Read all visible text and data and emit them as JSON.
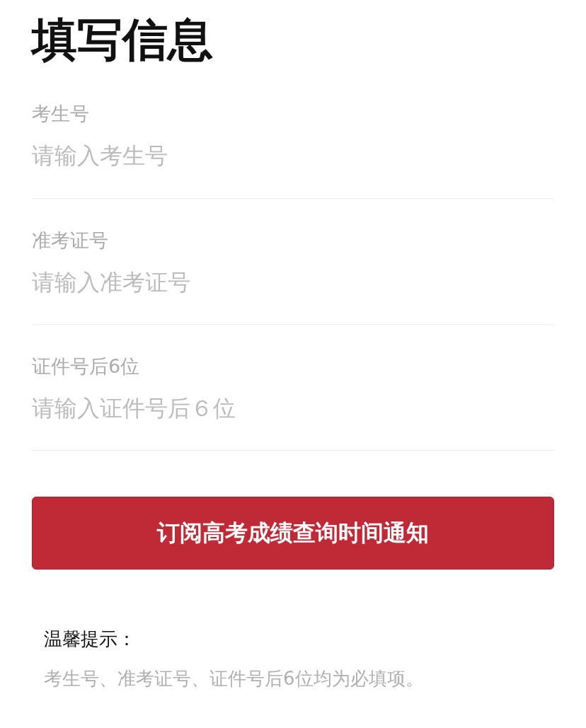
{
  "title": "填写信息",
  "fields": [
    {
      "label": "考生号",
      "placeholder": "请输入考生号"
    },
    {
      "label": "准考证号",
      "placeholder": "请输入准考证号"
    },
    {
      "label": "证件号后6位",
      "placeholder": "请输入证件号后６位"
    }
  ],
  "submit_button": "订阅高考成绩查询时间通知",
  "tips": {
    "title": "温馨提示：",
    "text": "考生号、准考证号、证件号后6位均为必填项。"
  }
}
